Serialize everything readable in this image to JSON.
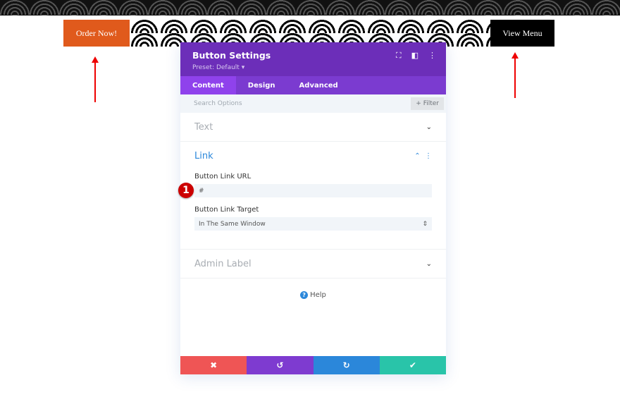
{
  "page": {
    "order_button": "Order Now!",
    "view_menu_button": "View Menu"
  },
  "modal": {
    "title": "Button Settings",
    "preset": "Preset: Default ▾",
    "tabs": [
      {
        "label": "Content"
      },
      {
        "label": "Design"
      },
      {
        "label": "Advanced"
      }
    ],
    "search_placeholder": "Search Options",
    "filter_label": "+ Filter",
    "sections": {
      "text": "Text",
      "link": "Link",
      "admin": "Admin Label"
    },
    "link": {
      "url_label": "Button Link URL",
      "url_value": "#",
      "target_label": "Button Link Target",
      "target_value": "In The Same Window"
    },
    "badge": "1",
    "help": "Help"
  },
  "colors": {
    "header": "#6c2eb9",
    "tabs": "#7b3bd0",
    "cancel": "#ef5555",
    "undo": "#7e3bd0",
    "redo": "#2b87da",
    "save": "#29c4a9",
    "accent_link": "#2b87da",
    "annotation": "#e00000"
  }
}
